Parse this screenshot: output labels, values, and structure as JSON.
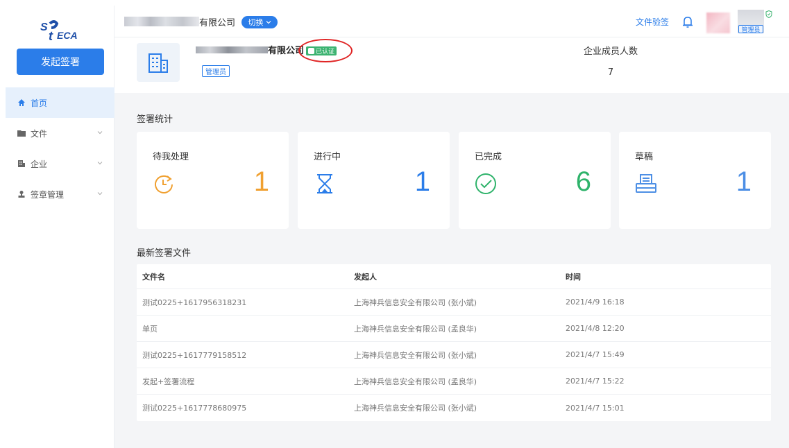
{
  "app": {
    "logo_text": "SHECA"
  },
  "sidebar": {
    "start_button": "发起签署",
    "items": [
      {
        "label": "首页",
        "icon": "home-icon",
        "active": true
      },
      {
        "label": "文件",
        "icon": "folder-icon",
        "active": false
      },
      {
        "label": "企业",
        "icon": "enterprise-icon",
        "active": false
      },
      {
        "label": "签章管理",
        "icon": "seal-icon",
        "active": false
      }
    ]
  },
  "header": {
    "company_suffix": "有限公司",
    "switch_label": "切换",
    "verify_link": "文件验签",
    "user_role": "管理员"
  },
  "corp": {
    "name_suffix": "有限公司",
    "verified_label": "已认证",
    "role_tag": "管理员",
    "members_label": "企业成员人数",
    "members_value": "7"
  },
  "stats": {
    "title": "签署统计",
    "cards": [
      {
        "label": "待我处理",
        "value": "1",
        "icon": "clock-arrow-icon",
        "color": "#f0a030"
      },
      {
        "label": "进行中",
        "value": "1",
        "icon": "hourglass-icon",
        "color": "#2b7de9"
      },
      {
        "label": "已完成",
        "value": "6",
        "icon": "check-circle-icon",
        "color": "#2fb36b"
      },
      {
        "label": "草稿",
        "value": "1",
        "icon": "printer-icon",
        "color": "#4d8fe5"
      }
    ]
  },
  "docs": {
    "title": "最新签署文件",
    "columns": [
      "文件名",
      "发起人",
      "时间"
    ],
    "rows": [
      [
        "测试0225+1617956318231",
        "上海神兵信息安全有限公司 (张小斌)",
        "2021/4/9 16:18"
      ],
      [
        "单页",
        "上海神兵信息安全有限公司 (孟良华)",
        "2021/4/8 12:20"
      ],
      [
        "测试0225+1617779158512",
        "上海神兵信息安全有限公司 (张小斌)",
        "2021/4/7 15:49"
      ],
      [
        "发起+签署流程",
        "上海神兵信息安全有限公司 (孟良华)",
        "2021/4/7 15:22"
      ],
      [
        "测试0225+1617778680975",
        "上海神兵信息安全有限公司 (张小斌)",
        "2021/4/7 15:01"
      ]
    ]
  },
  "colors": {
    "primary": "#2b7de9",
    "verified": "#3cb371",
    "highlight": "#e02424"
  }
}
